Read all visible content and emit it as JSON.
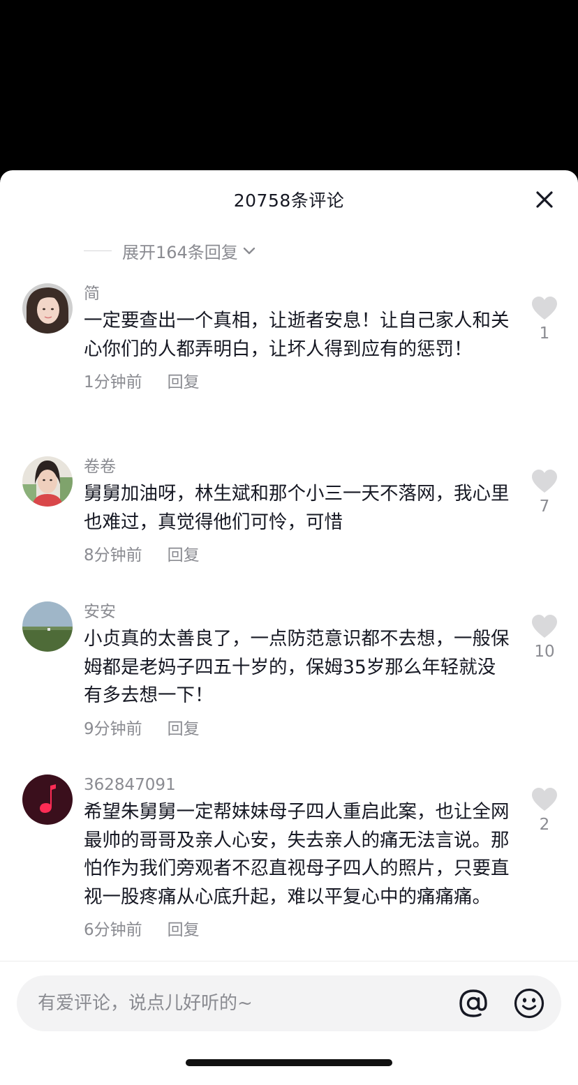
{
  "header": {
    "title": "20758条评论"
  },
  "expand": {
    "label": "展开164条回复"
  },
  "comments": [
    {
      "username": "简",
      "text": "一定要查出一个真相，让逝者安息！让自己家人和关心你们的人都弄明白，让坏人得到应有的惩罚！",
      "time": "1分钟前",
      "reply_label": "回复",
      "likes": "1"
    },
    {
      "username": "卷卷",
      "text": "舅舅加油呀，林生斌和那个小三一天不落网，我心里也难过，真觉得他们可怜，可惜",
      "time": "8分钟前",
      "reply_label": "回复",
      "likes": "7"
    },
    {
      "username": "安安",
      "text": "小贞真的太善良了，一点防范意识都不去想，一般保姆都是老妈子四五十岁的，保姆35岁那么年轻就没有多去想一下！",
      "time": "9分钟前",
      "reply_label": "回复",
      "likes": "10"
    },
    {
      "username": "362847091",
      "text": "希望朱舅舅一定帮妹妹母子四人重启此案，也让全网最帅的哥哥及亲人心安，失去亲人的痛无法言说。那怕作为我们旁观者不忍直视母子四人的照片，只要直视一股疼痛从心底升起，难以平复心中的痛痛痛。",
      "time": "6分钟前",
      "reply_label": "回复",
      "likes": "2"
    }
  ],
  "input": {
    "placeholder": "有爱评论，说点儿好听的~",
    "value": ""
  },
  "icons": {
    "close": "close-icon",
    "chevron": "chevron-down-icon",
    "like": "heart-icon",
    "at": "at-icon",
    "emoji": "smiley-icon"
  },
  "colors": {
    "primary_text": "#161823",
    "secondary_text": "#8a8b91",
    "heart": "#d9d9db",
    "music_avatar_bg": "#3a0f1c",
    "music_note": "#fe2c55"
  }
}
